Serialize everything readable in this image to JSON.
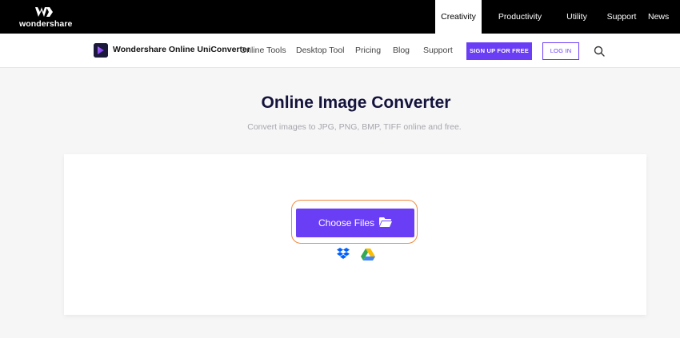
{
  "brand": {
    "name": "wondershare"
  },
  "top_nav": [
    {
      "label": "Creativity",
      "active": true
    },
    {
      "label": "Productivity"
    },
    {
      "label": "Utility"
    },
    {
      "label": "Support"
    },
    {
      "label": "News"
    }
  ],
  "sub_nav": {
    "product_name": "Wondershare Online UniConverter",
    "links": [
      "Online Tools",
      "Desktop Tool",
      "Pricing",
      "Blog",
      "Support"
    ],
    "signup_label": "SIGN UP FOR FREE",
    "login_label": "LOG IN",
    "search_icon": "search-icon"
  },
  "hero": {
    "title": "Online Image Converter",
    "subtitle": "Convert images to JPG, PNG, BMP, TIFF online and free."
  },
  "upload": {
    "choose_label": "Choose Files",
    "icons": [
      "folder-icon",
      "dropbox-icon",
      "google-drive-icon"
    ]
  },
  "colors": {
    "accent": "#6a3ef5",
    "highlight_ring": "#f08a3e",
    "title": "#14133b"
  }
}
